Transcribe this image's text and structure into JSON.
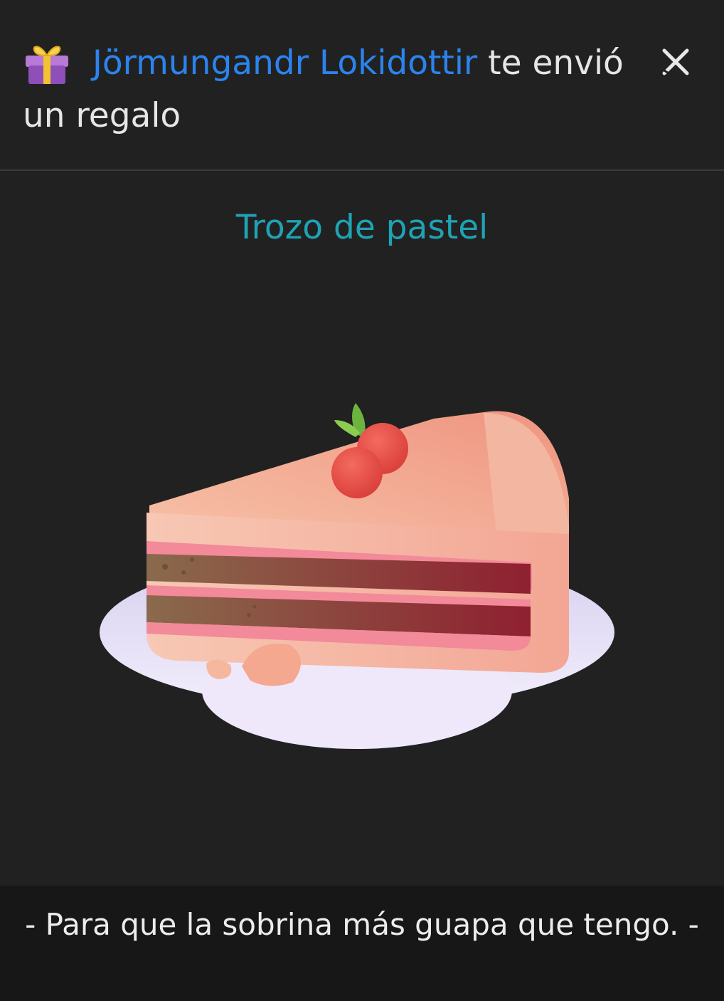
{
  "header": {
    "sender_name": "Jörmungandr Lokidottir",
    "message_after_name": "te envió un regalo",
    "gift_icon": "gift-emoji-icon",
    "close_icon": "close-icon"
  },
  "gift": {
    "name": "Trozo de pastel",
    "image": "cake-slice-illustration"
  },
  "message": {
    "text": "- Para que la sobrina más guapa que tengo. -"
  },
  "colors": {
    "background": "#212121",
    "sender_name": "#2b84ee",
    "gift_name": "#1fa3b4",
    "message_bar": "#171717"
  }
}
